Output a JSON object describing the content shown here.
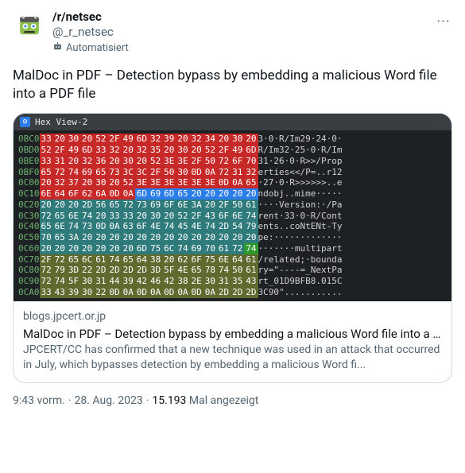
{
  "post": {
    "display_name": "/r/netsec",
    "handle": "@_r_netsec",
    "automated_label": "Automatisiert",
    "more_label": "···",
    "text": "MalDoc in PDF – Detection bypass by embedding a malicious Word file into a PDF file"
  },
  "card": {
    "hex_title": "Hex View-2",
    "domain": "blogs.jpcert.or.jp",
    "title": "MalDoc in PDF – Detection bypass by embedding a malicious Word file into a ...",
    "description": "JPCERT/CC has confirmed that a new technique was used in an attack that occurred in July, which bypasses detection by embedding a malicious Word fi..."
  },
  "meta": {
    "time": "9:43 vorm.",
    "date": "28. Aug. 2023",
    "views_count": "15.193",
    "views_label": "Mal angezeigt"
  },
  "hex_rows": [
    {
      "addr": "0BC0",
      "bytes": [
        [
          "33",
          "r"
        ],
        [
          "20",
          "r"
        ],
        [
          "30",
          "r"
        ],
        [
          "20",
          "r"
        ],
        [
          "52",
          "r"
        ],
        [
          "2F",
          "r"
        ],
        [
          "49",
          "r"
        ],
        [
          "6D",
          "r"
        ],
        [
          "32",
          "r"
        ],
        [
          "39",
          "r"
        ],
        [
          "20",
          "r"
        ],
        [
          "32",
          "r"
        ],
        [
          "34",
          "r"
        ],
        [
          "20",
          "r"
        ],
        [
          "30",
          "r"
        ],
        [
          "20",
          "r"
        ]
      ],
      "ascii": "3·0·R/Im29·24·0·"
    },
    {
      "addr": "0BD0",
      "bytes": [
        [
          "52",
          "r"
        ],
        [
          "2F",
          "r"
        ],
        [
          "49",
          "r"
        ],
        [
          "6D",
          "r"
        ],
        [
          "33",
          "r"
        ],
        [
          "32",
          "r"
        ],
        [
          "20",
          "r"
        ],
        [
          "32",
          "r"
        ],
        [
          "35",
          "r"
        ],
        [
          "20",
          "r"
        ],
        [
          "30",
          "r"
        ],
        [
          "20",
          "r"
        ],
        [
          "52",
          "r"
        ],
        [
          "2F",
          "r"
        ],
        [
          "49",
          "r"
        ],
        [
          "6D",
          "r"
        ]
      ],
      "ascii": "R/Im32·25·0·R/Im"
    },
    {
      "addr": "0BE0",
      "bytes": [
        [
          "33",
          "r"
        ],
        [
          "31",
          "r"
        ],
        [
          "20",
          "r"
        ],
        [
          "32",
          "r"
        ],
        [
          "36",
          "r"
        ],
        [
          "20",
          "r"
        ],
        [
          "30",
          "r"
        ],
        [
          "20",
          "r"
        ],
        [
          "52",
          "r"
        ],
        [
          "3E",
          "r"
        ],
        [
          "3E",
          "r"
        ],
        [
          "2F",
          "r"
        ],
        [
          "50",
          "r"
        ],
        [
          "72",
          "r"
        ],
        [
          "6F",
          "r"
        ],
        [
          "70",
          "r"
        ]
      ],
      "ascii": "31·26·0·R>>/Prop"
    },
    {
      "addr": "0BF0",
      "bytes": [
        [
          "65",
          "r"
        ],
        [
          "72",
          "r"
        ],
        [
          "74",
          "r"
        ],
        [
          "69",
          "r"
        ],
        [
          "65",
          "r"
        ],
        [
          "73",
          "r"
        ],
        [
          "3C",
          "r"
        ],
        [
          "3C",
          "r"
        ],
        [
          "2F",
          "r"
        ],
        [
          "50",
          "r"
        ],
        [
          "30",
          "r"
        ],
        [
          "0D",
          "r"
        ],
        [
          "0A",
          "r"
        ],
        [
          "72",
          "r"
        ],
        [
          "31",
          "r"
        ],
        [
          "32",
          "r"
        ]
      ],
      "ascii": "erties<</P=..r12"
    },
    {
      "addr": "0C00",
      "bytes": [
        [
          "20",
          "r"
        ],
        [
          "32",
          "r"
        ],
        [
          "37",
          "r"
        ],
        [
          "20",
          "r"
        ],
        [
          "30",
          "r"
        ],
        [
          "20",
          "r"
        ],
        [
          "52",
          "r"
        ],
        [
          "3E",
          "r"
        ],
        [
          "3E",
          "r"
        ],
        [
          "3E",
          "r"
        ],
        [
          "3E",
          "r"
        ],
        [
          "3E",
          "r"
        ],
        [
          "3E",
          "r"
        ],
        [
          "0D",
          "r"
        ],
        [
          "0A",
          "r"
        ],
        [
          "65",
          "r"
        ]
      ],
      "ascii": "·27·0·R>>>>>>..e"
    },
    {
      "addr": "0C10",
      "bytes": [
        [
          "6E",
          "r"
        ],
        [
          "64",
          "r"
        ],
        [
          "6F",
          "r"
        ],
        [
          "62",
          "r"
        ],
        [
          "6A",
          "r"
        ],
        [
          "0D",
          "r"
        ],
        [
          "0A",
          "r"
        ],
        [
          "6D",
          "b"
        ],
        [
          "69",
          "b"
        ],
        [
          "6D",
          "b"
        ],
        [
          "65",
          "b"
        ],
        [
          "20",
          "b"
        ],
        [
          "20",
          "b"
        ],
        [
          "20",
          "b"
        ],
        [
          "20",
          "b"
        ],
        [
          "20",
          "b"
        ]
      ],
      "ascii": "ndobj..mime·····"
    },
    {
      "addr": "0C20",
      "bytes": [
        [
          "20",
          "t"
        ],
        [
          "20",
          "t"
        ],
        [
          "20",
          "t"
        ],
        [
          "2D",
          "t"
        ],
        [
          "56",
          "t"
        ],
        [
          "65",
          "t"
        ],
        [
          "72",
          "t"
        ],
        [
          "73",
          "t"
        ],
        [
          "69",
          "t"
        ],
        [
          "6F",
          "t"
        ],
        [
          "6E",
          "t"
        ],
        [
          "3A",
          "t"
        ],
        [
          "20",
          "t"
        ],
        [
          "2F",
          "t"
        ],
        [
          "50",
          "t"
        ],
        [
          "61",
          "t"
        ]
      ],
      "ascii": "····Version:·/Pa"
    },
    {
      "addr": "0C30",
      "bytes": [
        [
          "72",
          "t"
        ],
        [
          "65",
          "t"
        ],
        [
          "6E",
          "t"
        ],
        [
          "74",
          "t"
        ],
        [
          "20",
          "t"
        ],
        [
          "33",
          "t"
        ],
        [
          "33",
          "t"
        ],
        [
          "20",
          "t"
        ],
        [
          "30",
          "t"
        ],
        [
          "20",
          "t"
        ],
        [
          "52",
          "t"
        ],
        [
          "2F",
          "t"
        ],
        [
          "43",
          "t"
        ],
        [
          "6F",
          "t"
        ],
        [
          "6E",
          "t"
        ],
        [
          "74",
          "t"
        ]
      ],
      "ascii": "rent·33·0·R/Cont"
    },
    {
      "addr": "0C40",
      "bytes": [
        [
          "65",
          "t"
        ],
        [
          "6E",
          "t"
        ],
        [
          "74",
          "t"
        ],
        [
          "73",
          "t"
        ],
        [
          "0D",
          "t"
        ],
        [
          "0A",
          "t"
        ],
        [
          "63",
          "t"
        ],
        [
          "6F",
          "t"
        ],
        [
          "4E",
          "t"
        ],
        [
          "74",
          "t"
        ],
        [
          "45",
          "t"
        ],
        [
          "4E",
          "t"
        ],
        [
          "74",
          "t"
        ],
        [
          "2D",
          "t"
        ],
        [
          "54",
          "t"
        ],
        [
          "79",
          "t"
        ]
      ],
      "ascii": "ents..coNtENt-Ty"
    },
    {
      "addr": "0C50",
      "bytes": [
        [
          "70",
          "t"
        ],
        [
          "65",
          "t"
        ],
        [
          "3A",
          "t"
        ],
        [
          "20",
          "t"
        ],
        [
          "20",
          "t"
        ],
        [
          "20",
          "t"
        ],
        [
          "20",
          "t"
        ],
        [
          "20",
          "t"
        ],
        [
          "20",
          "t"
        ],
        [
          "20",
          "t"
        ],
        [
          "20",
          "t"
        ],
        [
          "20",
          "t"
        ],
        [
          "20",
          "t"
        ],
        [
          "20",
          "t"
        ],
        [
          "20",
          "t"
        ],
        [
          "20",
          "t"
        ]
      ],
      "ascii": "pe:·············"
    },
    {
      "addr": "0C60",
      "bytes": [
        [
          "20",
          "t"
        ],
        [
          "20",
          "t"
        ],
        [
          "20",
          "t"
        ],
        [
          "20",
          "t"
        ],
        [
          "20",
          "t"
        ],
        [
          "20",
          "t"
        ],
        [
          "20",
          "t"
        ],
        [
          "6D",
          "t"
        ],
        [
          "75",
          "t"
        ],
        [
          "6C",
          "t"
        ],
        [
          "74",
          "t"
        ],
        [
          "69",
          "t"
        ],
        [
          "70",
          "t"
        ],
        [
          "61",
          "t"
        ],
        [
          "72",
          "t"
        ],
        [
          "74",
          "g"
        ]
      ],
      "ascii": "·······multipart"
    },
    {
      "addr": "0C70",
      "bytes": [
        [
          "2F",
          "o"
        ],
        [
          "72",
          "o"
        ],
        [
          "65",
          "o"
        ],
        [
          "6C",
          "o"
        ],
        [
          "61",
          "o"
        ],
        [
          "74",
          "o"
        ],
        [
          "65",
          "o"
        ],
        [
          "64",
          "o"
        ],
        [
          "38",
          "o"
        ],
        [
          "20",
          "o"
        ],
        [
          "62",
          "o"
        ],
        [
          "6F",
          "o"
        ],
        [
          "75",
          "o"
        ],
        [
          "6E",
          "o"
        ],
        [
          "64",
          "o"
        ],
        [
          "61",
          "o"
        ]
      ],
      "ascii": "/related;·bounda"
    },
    {
      "addr": "0C80",
      "bytes": [
        [
          "72",
          "o"
        ],
        [
          "79",
          "o"
        ],
        [
          "3D",
          "o"
        ],
        [
          "22",
          "o"
        ],
        [
          "2D",
          "o"
        ],
        [
          "2D",
          "o"
        ],
        [
          "2D",
          "o"
        ],
        [
          "2D",
          "o"
        ],
        [
          "3D",
          "o"
        ],
        [
          "5F",
          "o"
        ],
        [
          "4E",
          "o"
        ],
        [
          "65",
          "o"
        ],
        [
          "78",
          "o"
        ],
        [
          "74",
          "o"
        ],
        [
          "50",
          "o"
        ],
        [
          "61",
          "o"
        ]
      ],
      "ascii": "ry=\"----=_NextPa"
    },
    {
      "addr": "0C90",
      "bytes": [
        [
          "72",
          "o"
        ],
        [
          "74",
          "o"
        ],
        [
          "5F",
          "o"
        ],
        [
          "30",
          "o"
        ],
        [
          "31",
          "o"
        ],
        [
          "44",
          "o"
        ],
        [
          "39",
          "o"
        ],
        [
          "42",
          "o"
        ],
        [
          "46",
          "o"
        ],
        [
          "42",
          "o"
        ],
        [
          "38",
          "o"
        ],
        [
          "2E",
          "o"
        ],
        [
          "30",
          "o"
        ],
        [
          "31",
          "o"
        ],
        [
          "35",
          "o"
        ],
        [
          "43",
          "o"
        ]
      ],
      "ascii": "rt_01D9BFB8.015C"
    },
    {
      "addr": "0CA0",
      "bytes": [
        [
          "33",
          "o"
        ],
        [
          "43",
          "o"
        ],
        [
          "39",
          "o"
        ],
        [
          "30",
          "o"
        ],
        [
          "22",
          "o"
        ],
        [
          "0D",
          "o"
        ],
        [
          "0A",
          "o"
        ],
        [
          "0D",
          "o"
        ],
        [
          "0A",
          "o"
        ],
        [
          "0D",
          "o"
        ],
        [
          "0A",
          "o"
        ],
        [
          "0D",
          "o"
        ],
        [
          "0A",
          "o"
        ],
        [
          "2D",
          "o"
        ],
        [
          "2D",
          "o"
        ],
        [
          "2D",
          "o"
        ]
      ],
      "ascii": "3C90\"..........."
    }
  ]
}
